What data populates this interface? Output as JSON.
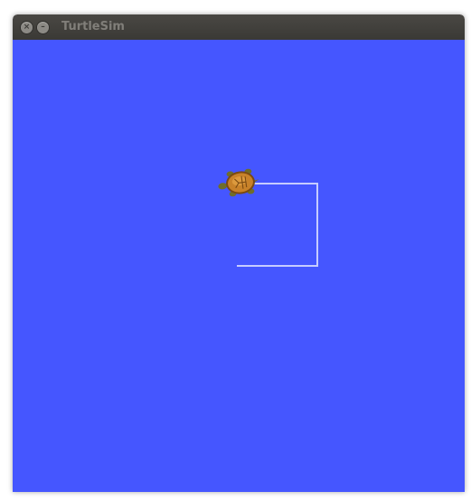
{
  "window": {
    "title": "TurtleSim",
    "close_icon": "close-icon",
    "minimize_icon": "minimize-icon"
  },
  "canvas": {
    "background_color": "#4556ff",
    "trail_color": "#c6ccff",
    "turtle_shell_color": "#c8822a",
    "turtle_skin_color": "#6f6d2a"
  }
}
